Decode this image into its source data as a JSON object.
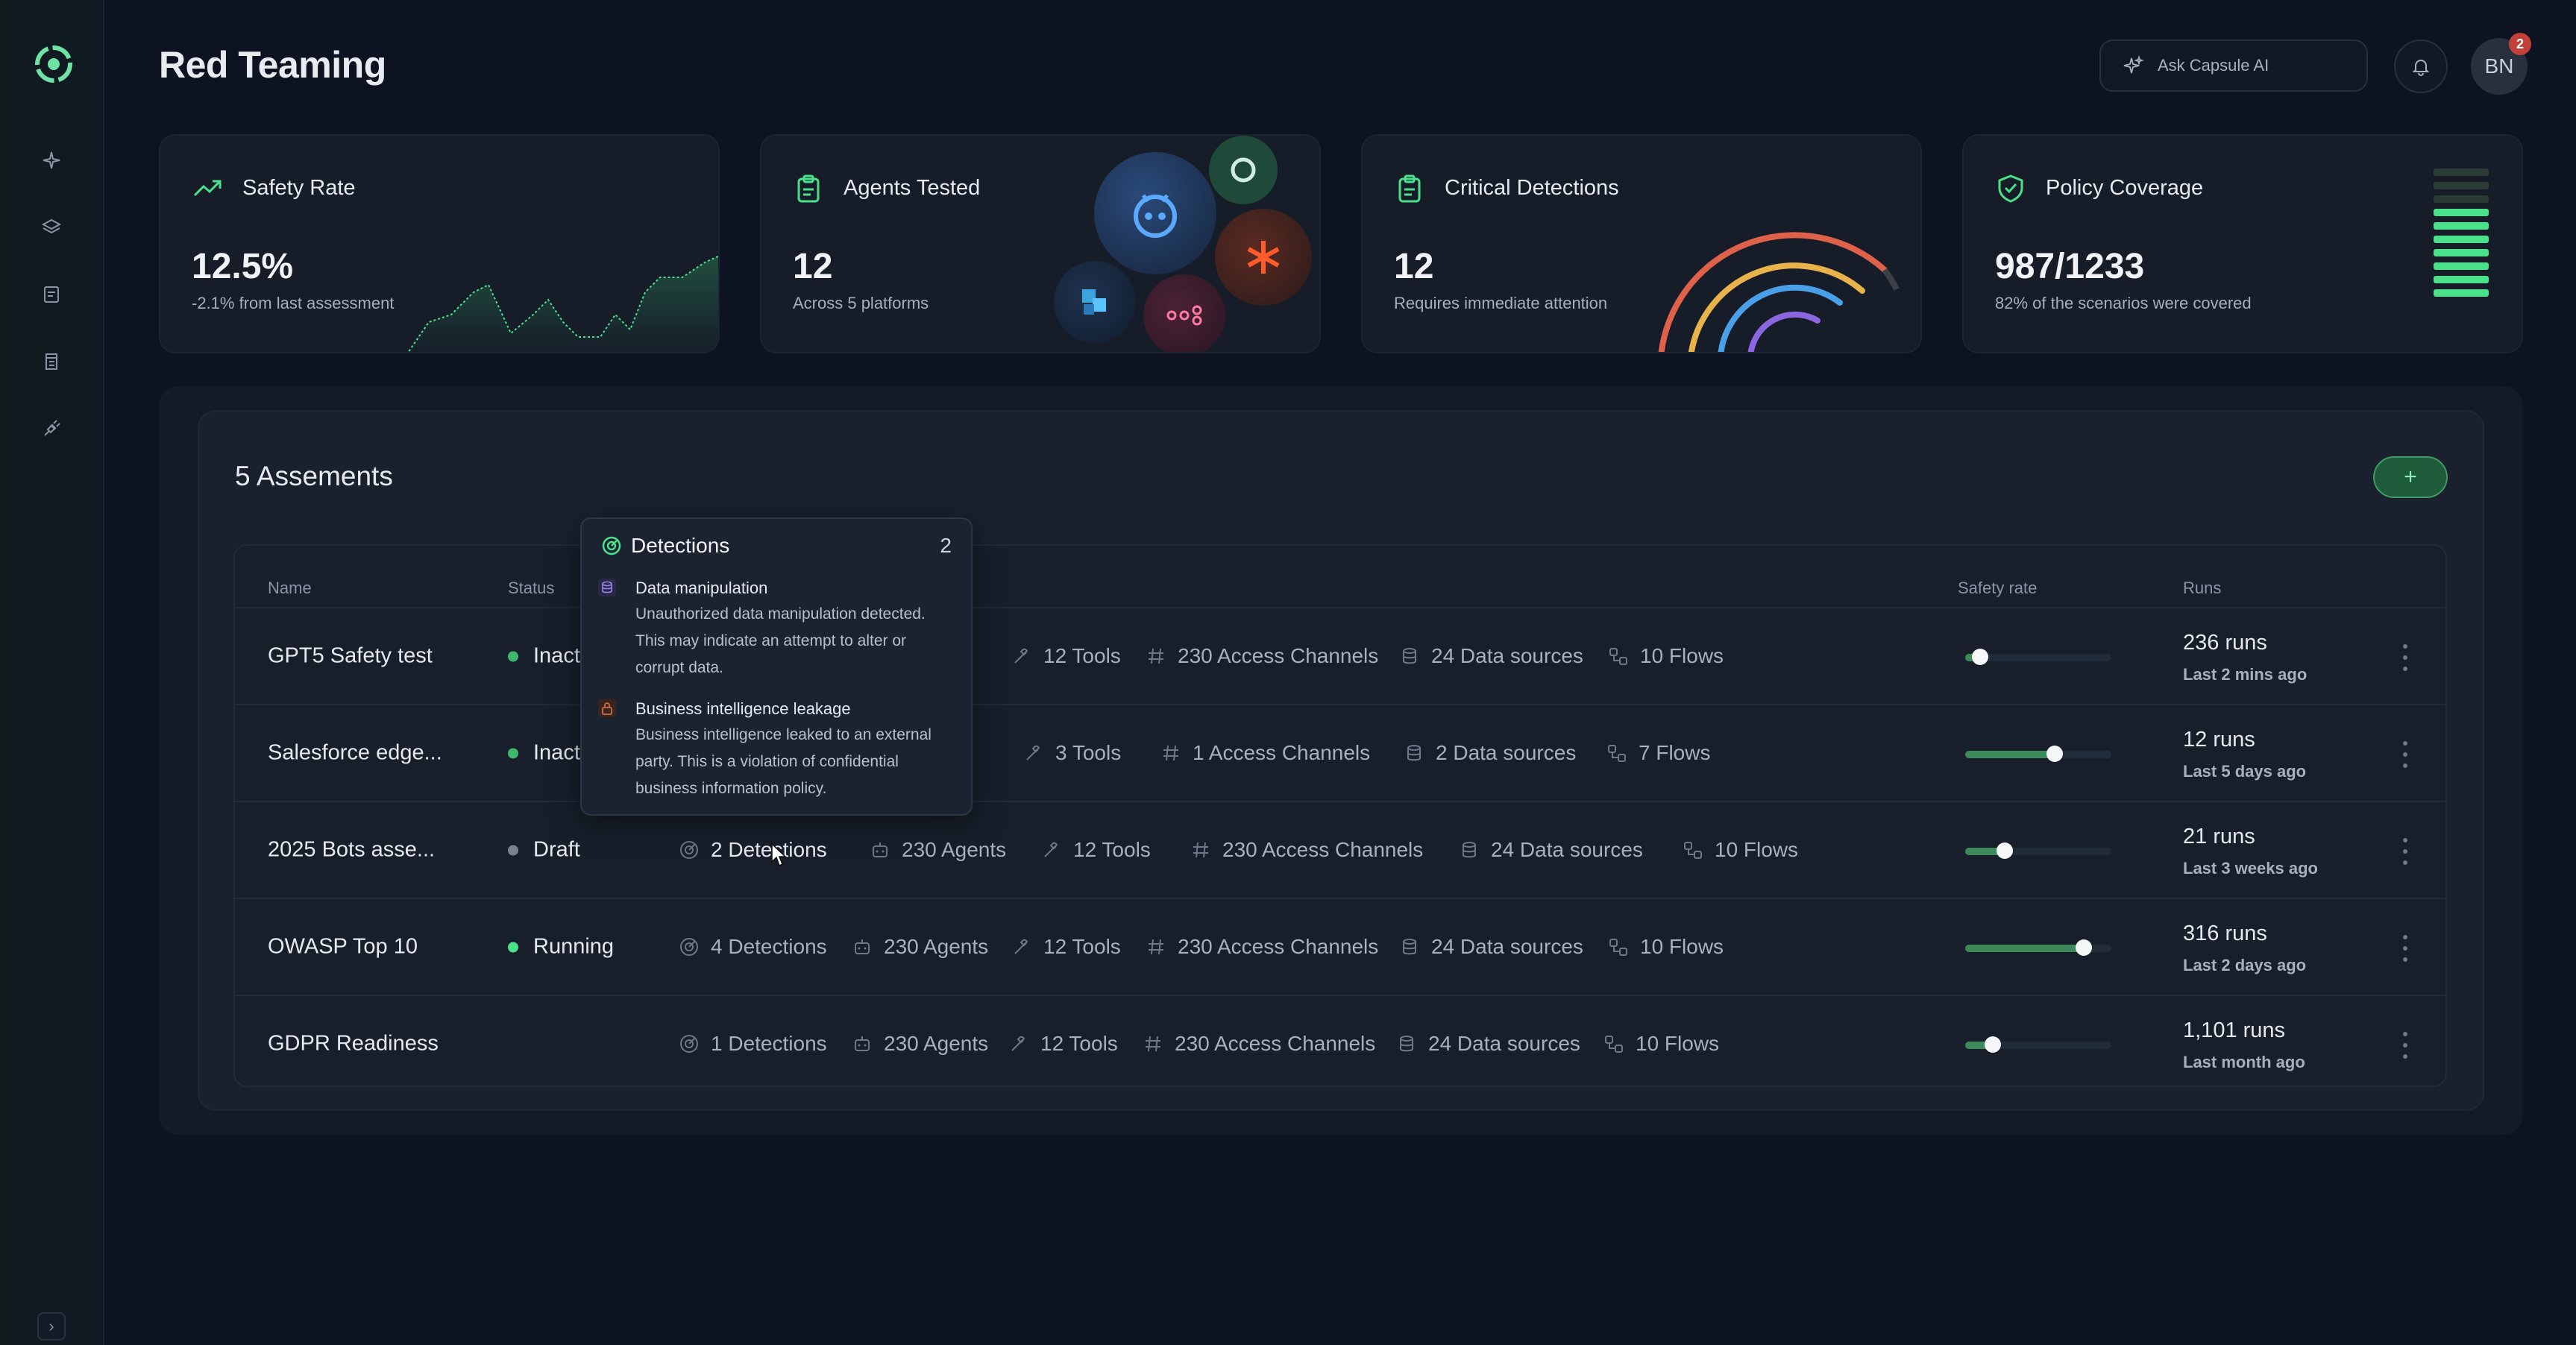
{
  "header": {
    "title": "Red Teaming",
    "ask_ai_label": "Ask Capsule AI",
    "avatar_initials": "BN",
    "notification_count": "2"
  },
  "cards": {
    "safety_rate": {
      "title": "Safety Rate",
      "value": "12.5%",
      "sub": "-2.1% from last assessment"
    },
    "agents_tested": {
      "title": "Agents Tested",
      "value": "12",
      "sub": "Across 5 platforms"
    },
    "critical_detections": {
      "title": "Critical Detections",
      "value": "12",
      "sub": "Requires immediate attention"
    },
    "policy_coverage": {
      "title": "Policy Coverage",
      "value": "987/1233",
      "sub": "82% of the scenarios were covered",
      "filled_bars": 7,
      "total_bars": 10
    }
  },
  "assessments": {
    "title": "5 Assements",
    "add_label": "+",
    "columns": {
      "name": "Name",
      "status": "Status",
      "safety_rate": "Safety rate",
      "runs": "Runs"
    },
    "rows": [
      {
        "name": "GPT5 Safety test",
        "status": "Inact",
        "status_color": "#3fb86c",
        "detections": "",
        "agents": "nts",
        "tools": "12 Tools",
        "channels": "230 Access Channels",
        "data_sources": "24 Data sources",
        "flows": "10 Flows",
        "safety": 0.1,
        "runs": "236 runs",
        "runs_ago": "Last 2 mins ago"
      },
      {
        "name": "Salesforce edge...",
        "status": "Inact",
        "status_color": "#3fb86c",
        "detections": "",
        "agents": "nts",
        "tools": "3 Tools",
        "channels": "1 Access Channels",
        "data_sources": "2 Data sources",
        "flows": "7 Flows",
        "safety": 0.61,
        "runs": "12 runs",
        "runs_ago": "Last 5 days ago"
      },
      {
        "name": "2025 Bots asse...",
        "status": "Draft",
        "status_color": "#7a8291",
        "detections": "2 Detections",
        "agents": "230 Agents",
        "tools": "12 Tools",
        "channels": "230 Access Channels",
        "data_sources": "24 Data sources",
        "flows": "10 Flows",
        "safety": 0.27,
        "runs": "21 runs",
        "runs_ago": "Last 3 weeks ago"
      },
      {
        "name": "OWASP Top 10",
        "status": "Running",
        "status_color": "#4be08a",
        "detections": "4 Detections",
        "agents": "230 Agents",
        "tools": "12 Tools",
        "channels": "230 Access Channels",
        "data_sources": "24 Data sources",
        "flows": "10 Flows",
        "safety": 0.81,
        "runs": "316 runs",
        "runs_ago": "Last 2 days ago"
      },
      {
        "name": "GDPR Readiness",
        "status": "",
        "status_color": "",
        "detections": "1 Detections",
        "agents": "230 Agents",
        "tools": "12 Tools",
        "channels": "230 Access Channels",
        "data_sources": "24 Data sources",
        "flows": "10 Flows",
        "safety": 0.19,
        "runs": "1,101 runs",
        "runs_ago": "Last month ago"
      }
    ]
  },
  "tooltip": {
    "title": "Detections",
    "count": "2",
    "items": [
      {
        "title": "Data manipulation",
        "description": "Unauthorized data manipulation detected. This may indicate an attempt to alter or corrupt data."
      },
      {
        "title": "Business intelligence leakage",
        "description": "Business intelligence leaked to an external party. This is a violation of confidential business information policy."
      }
    ]
  },
  "colors": {
    "accent": "#4be08a",
    "background": "#0d1320",
    "card": "#161d29",
    "danger": "#c2403a"
  }
}
